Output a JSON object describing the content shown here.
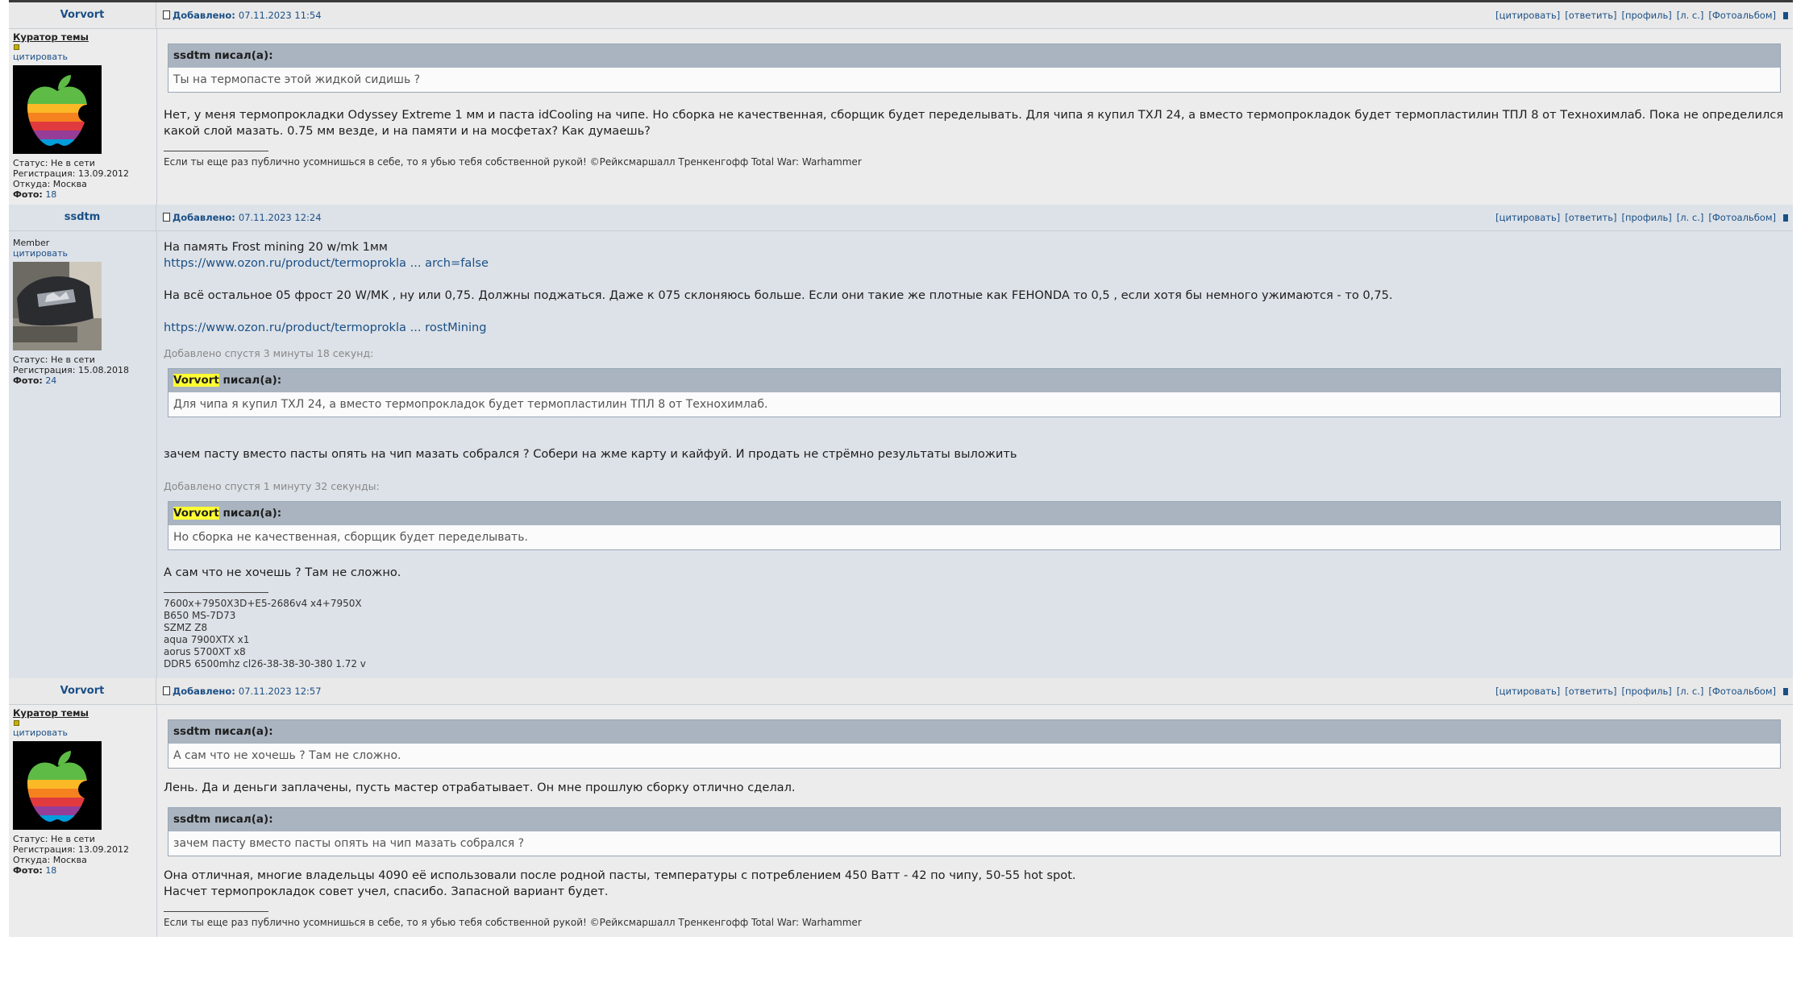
{
  "posts": [
    {
      "author": "Vorvort",
      "added_label": "Добавлено:",
      "date": "07.11.2023 11:54",
      "actions": [
        "[цитировать]",
        "[ответить]",
        "[профиль]",
        "[л. с.]",
        "[Фотоальбом]"
      ],
      "side": {
        "rank": "Куратор темы",
        "quote_link": "цитировать",
        "status": "Статус: Не в сети",
        "registration": "Регистрация: 13.09.2012",
        "location": "Откуда: Москва",
        "photo_label": "Фото:",
        "photo_count": "18"
      },
      "quote1": {
        "head": "ssdtm писал(а):",
        "body": "Ты на термопасте этой жидкой сидишь ?"
      },
      "text1": "Нет, у меня термопрокладки Odyssey Extreme 1 мм и паста idCooling на чипе. Но сборка не качественная, сборщик будет переделывать. Для чипа я купил ТХЛ 24, а вместо термопрокладок будет термопластилин ТПЛ 8 от Технохимлаб. Пока не определился какой слой мазать. 0.75 мм везде, и на памяти и на мосфетах? Как думаешь?",
      "signature": "Если ты еще раз публично усомнишься в себе, то я убью тебя собственной рукой! ©Рейксмаршалл Тренкенгофф Total War: Warhammer"
    },
    {
      "author": "ssdtm",
      "added_label": "Добавлено:",
      "date": "07.11.2023 12:24",
      "actions": [
        "[цитировать]",
        "[ответить]",
        "[профиль]",
        "[л. с.]",
        "[Фотоальбом]"
      ],
      "side": {
        "rank": "Member",
        "quote_link": "цитировать",
        "status": "Статус: Не в сети",
        "registration": "Регистрация: 15.08.2018",
        "photo_label": "Фото:",
        "photo_count": "24"
      },
      "line1": "На память Frost mining 20 w/mk 1мм",
      "link1": "https://www.ozon.ru/product/termoprokla ... arch=false",
      "line2": "На всё остальное 05 фрост 20 W/MK , ну или 0,75. Должны поджаться. Даже к 075 склоняюсь больше. Если они такие же плотные как FEHONDA то 0,5 , если хотя бы немного ужимаются - то 0,75.",
      "link2": "https://www.ozon.ru/product/termoprokla ... rostMining",
      "edit1": "Добавлено спустя 3 минуты 18 секунд:",
      "quote1": {
        "user": "Vorvort",
        "head_suffix": " писал(а):",
        "body": "Для чипа я купил ТХЛ 24, а вместо термопрокладок будет термопластилин ТПЛ 8 от Технохимлаб."
      },
      "line3": "зачем пасту вместо пасты опять на чип мазать собрался ? Собери на жме карту и кайфуй. И продать не стрёмно результаты выложить",
      "edit2": "Добавлено спустя 1 минуту 32 секунды:",
      "quote2": {
        "user": "Vorvort",
        "head_suffix": " писал(а):",
        "body": "Но сборка не качественная, сборщик будет переделывать."
      },
      "line4": "А сам что не хочешь ? Там не сложно.",
      "signature": [
        "7600x+7950X3D+E5-2686v4 x4+7950X",
        "B650 MS-7D73",
        "SZMZ Z8",
        "aqua 7900XTX x1",
        "aorus 5700XT x8",
        "DDR5 6500mhz cl26-38-38-30-380 1.72 v"
      ]
    },
    {
      "author": "Vorvort",
      "added_label": "Добавлено:",
      "date": "07.11.2023 12:57",
      "actions": [
        "[цитировать]",
        "[ответить]",
        "[профиль]",
        "[л. с.]",
        "[Фотоальбом]"
      ],
      "side": {
        "rank": "Куратор темы",
        "quote_link": "цитировать",
        "status": "Статус: Не в сети",
        "registration": "Регистрация: 13.09.2012",
        "location": "Откуда: Москва",
        "photo_label": "Фото:",
        "photo_count": "18"
      },
      "quote1": {
        "head": "ssdtm писал(а):",
        "body": "А сам что не хочешь ? Там не сложно."
      },
      "text1": "Лень. Да и деньги заплачены, пусть мастер отрабатывает. Он мне прошлую сборку отлично сделал.",
      "quote2": {
        "head": "ssdtm писал(а):",
        "body": "зачем пасту вместо пасты опять на чип мазать собрался ?"
      },
      "text2": "Она отличная, многие владельцы 4090 её использовали после родной пасты, температуры с потреблением 450 Ватт - 42 по чипу, 50-55 hot spot.",
      "text3": "Насчет термопрокладок совет учел, спасибо. Запасной вариант будет.",
      "signature": "Если ты еще раз публично усомнишься в себе, то я убью тебя собственной рукой! ©Рейксмаршалл Тренкенгофф Total War: Warhammer"
    }
  ]
}
